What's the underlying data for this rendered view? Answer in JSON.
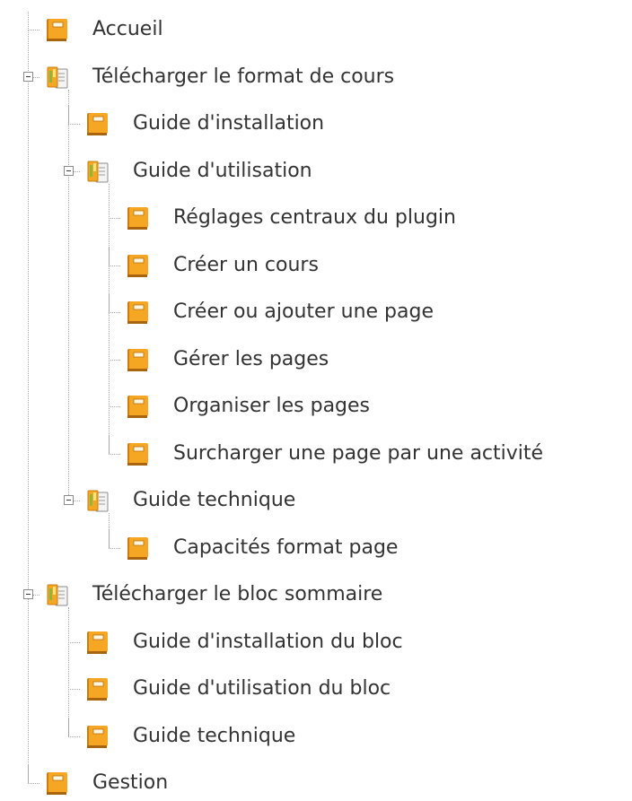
{
  "tree": [
    {
      "label": "Accueil",
      "type": "page",
      "depth": 0,
      "last": false
    },
    {
      "label": "Télécharger le format de cours",
      "type": "folder",
      "depth": 0,
      "last": false
    },
    {
      "label": "Guide d'installation",
      "type": "page",
      "depth": 1,
      "last": false
    },
    {
      "label": "Guide d'utilisation",
      "type": "folder",
      "depth": 1,
      "last": false
    },
    {
      "label": "Réglages centraux du plugin",
      "type": "page",
      "depth": 2,
      "last": false
    },
    {
      "label": "Créer un cours",
      "type": "page",
      "depth": 2,
      "last": false
    },
    {
      "label": "Créer ou ajouter une page",
      "type": "page",
      "depth": 2,
      "last": false
    },
    {
      "label": "Gérer les pages",
      "type": "page",
      "depth": 2,
      "last": false
    },
    {
      "label": "Organiser les pages",
      "type": "page",
      "depth": 2,
      "last": false
    },
    {
      "label": "Surcharger une page par une activité",
      "type": "page",
      "depth": 2,
      "last": true
    },
    {
      "label": "Guide technique",
      "type": "folder",
      "depth": 1,
      "last": true
    },
    {
      "label": "Capacités format page",
      "type": "page",
      "depth": 2,
      "last": true
    },
    {
      "label": "Télécharger le bloc sommaire",
      "type": "folder",
      "depth": 0,
      "last": false
    },
    {
      "label": "Guide d'installation du bloc",
      "type": "page",
      "depth": 1,
      "last": false
    },
    {
      "label": "Guide d'utilisation du bloc",
      "type": "page",
      "depth": 1,
      "last": false
    },
    {
      "label": "Guide technique",
      "type": "page",
      "depth": 1,
      "last": true
    },
    {
      "label": "Gestion",
      "type": "page",
      "depth": 0,
      "last": true
    }
  ],
  "icon_names": {
    "page": "book-icon",
    "folder": "open-book-icon",
    "toggle": "collapse-toggle-icon"
  },
  "colors": {
    "book_orange": "#F5A623",
    "book_dark": "#C97E12",
    "line": "#a8a8a8",
    "text": "#333333",
    "folder_green": "#8DB63C"
  }
}
